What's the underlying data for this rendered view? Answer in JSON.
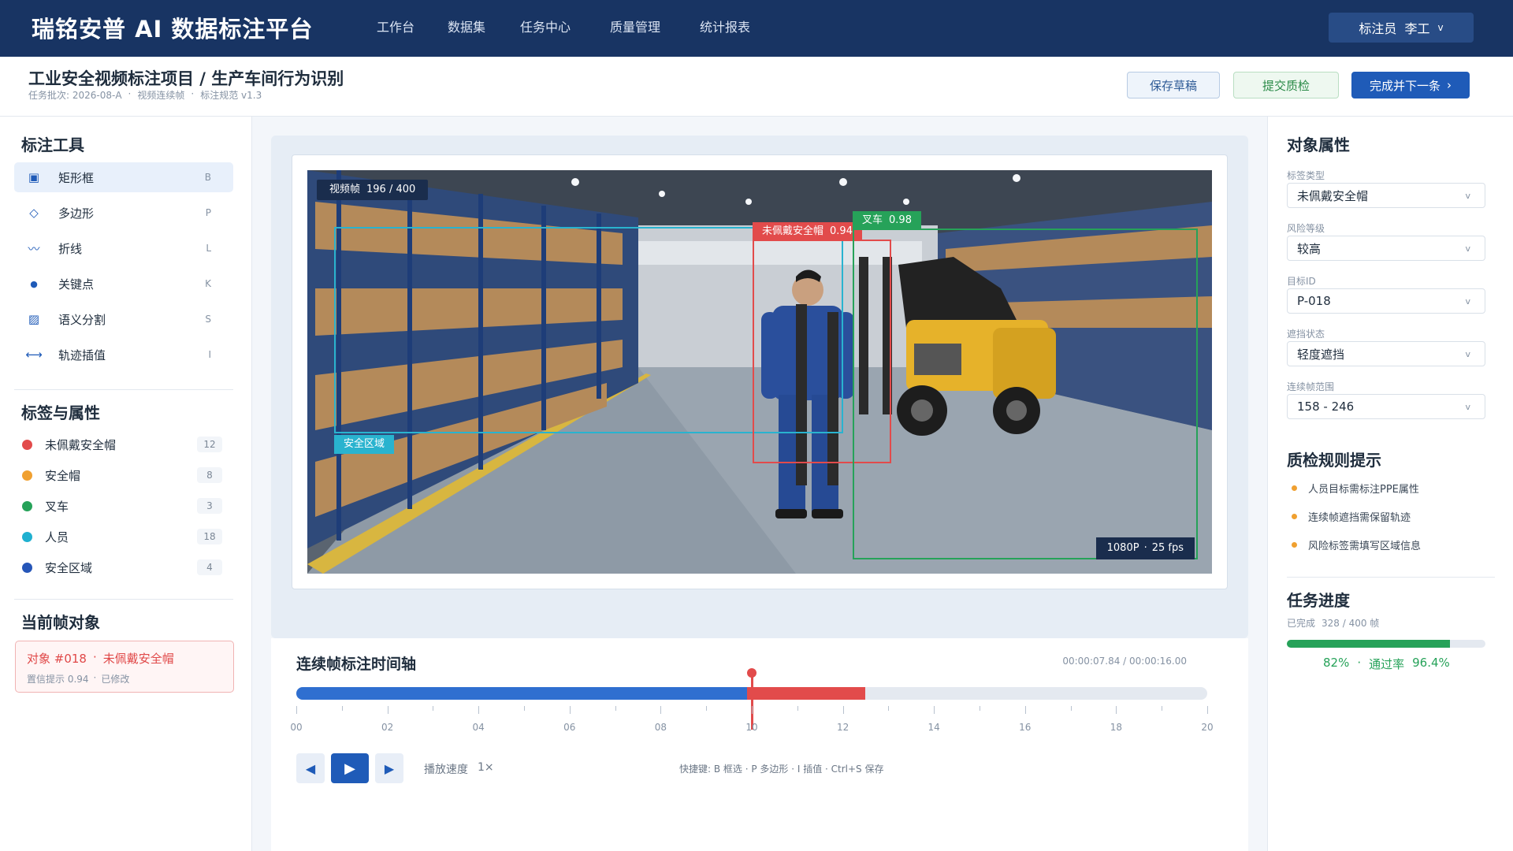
{
  "app": {
    "brand": "瑞铭安普 AI 数据标注平台",
    "nav": [
      "工作台",
      "数据集",
      "任务中心",
      "质量管理",
      "统计报表"
    ],
    "user": {
      "role": "标注员",
      "name": "李工",
      "chevron": "v"
    }
  },
  "header": {
    "title": "工业安全视频标注项目 / 生产车间行为识别",
    "meta": [
      "任务批次: 2026-08-A",
      "·",
      "视频连续帧",
      "·",
      "标注规范 v1.3"
    ],
    "buttons": {
      "draft": "保存草稿",
      "qc": "提交质检",
      "next": "完成并下一条",
      "next_arrow": "›"
    }
  },
  "tools": {
    "title": "标注工具",
    "items": [
      {
        "label": "矩形框",
        "key": "B",
        "icon": "rectangle-icon",
        "glyph": "▣",
        "active": true
      },
      {
        "label": "多边形",
        "key": "P",
        "icon": "polygon-icon",
        "glyph": "◇",
        "active": false
      },
      {
        "label": "折线",
        "key": "L",
        "icon": "polyline-icon",
        "glyph": "〰",
        "active": false
      },
      {
        "label": "关键点",
        "key": "K",
        "icon": "keypoint-icon",
        "glyph": "●",
        "active": false
      },
      {
        "label": "语义分割",
        "key": "S",
        "icon": "segmentation-icon",
        "glyph": "▨",
        "active": false
      },
      {
        "label": "轨迹插值",
        "key": "I",
        "icon": "interpolation-icon",
        "glyph": "⟷",
        "active": false
      }
    ]
  },
  "tags": {
    "title": "标签与属性",
    "items": [
      {
        "label": "未佩戴安全帽",
        "count": "12",
        "color": "#e24b4b"
      },
      {
        "label": "安全帽",
        "count": "8",
        "color": "#f0a030"
      },
      {
        "label": "叉车",
        "count": "3",
        "color": "#26a259"
      },
      {
        "label": "人员",
        "count": "18",
        "color": "#1fb0d0"
      },
      {
        "label": "安全区域",
        "count": "4",
        "color": "#2656b8"
      }
    ]
  },
  "current_object": {
    "title": "当前帧对象",
    "id": "对象 #018",
    "sep": "·",
    "label": "未佩戴安全帽",
    "confidence": "置信提示 0.94",
    "sep2": "·",
    "status": "已修改"
  },
  "viewer": {
    "frame_label": "视频帧",
    "frame_value": "196 / 400",
    "resolution": "1080P",
    "sep": "·",
    "fps": "25 fps",
    "boxes": [
      {
        "name": "safety-zone",
        "label": "安全区域",
        "score": "",
        "color": "#29b3cf"
      },
      {
        "name": "no-helmet",
        "label": "未佩戴安全帽",
        "score": "0.94",
        "color": "#e24b4b"
      },
      {
        "name": "forklift",
        "label": "叉车",
        "score": "0.98",
        "color": "#26a259"
      }
    ]
  },
  "timeline": {
    "title": "连续帧标注时间轴",
    "time": "00:00:07.84 / 00:00:16.00",
    "ticks": [
      "00",
      "02",
      "04",
      "06",
      "08",
      "10",
      "12",
      "14",
      "16",
      "18",
      "20"
    ],
    "range": [
      0,
      20
    ],
    "annotated_until": 9.9,
    "current_segment": [
      9.9,
      12.5
    ],
    "playhead": 10,
    "speed_label": "播放速度",
    "speed_value": "1×",
    "shortcuts": "快捷键:  B 框选  ·  P 多边形  ·  I 插值  ·  Ctrl+S 保存"
  },
  "properties": {
    "title": "对象属性",
    "fields": [
      {
        "label": "标签类型",
        "value": "未佩戴安全帽"
      },
      {
        "label": "风险等级",
        "value": "较高"
      },
      {
        "label": "目标ID",
        "value": "P-018"
      },
      {
        "label": "遮挡状态",
        "value": "轻度遮挡"
      },
      {
        "label": "连续帧范围",
        "value": "158 - 246"
      }
    ],
    "chevron": "v"
  },
  "rules": {
    "title": "质检规则提示",
    "items": [
      "人员目标需标注PPE属性",
      "连续帧遮挡需保留轨迹",
      "风险标签需填写区域信息"
    ]
  },
  "progress": {
    "title": "任务进度",
    "done_label": "已完成",
    "done_value": "328 / 400 帧",
    "fraction": 0.82,
    "percent": "82%",
    "sep": "·",
    "pass_label": "通过率",
    "pass_value": "96.4%"
  }
}
